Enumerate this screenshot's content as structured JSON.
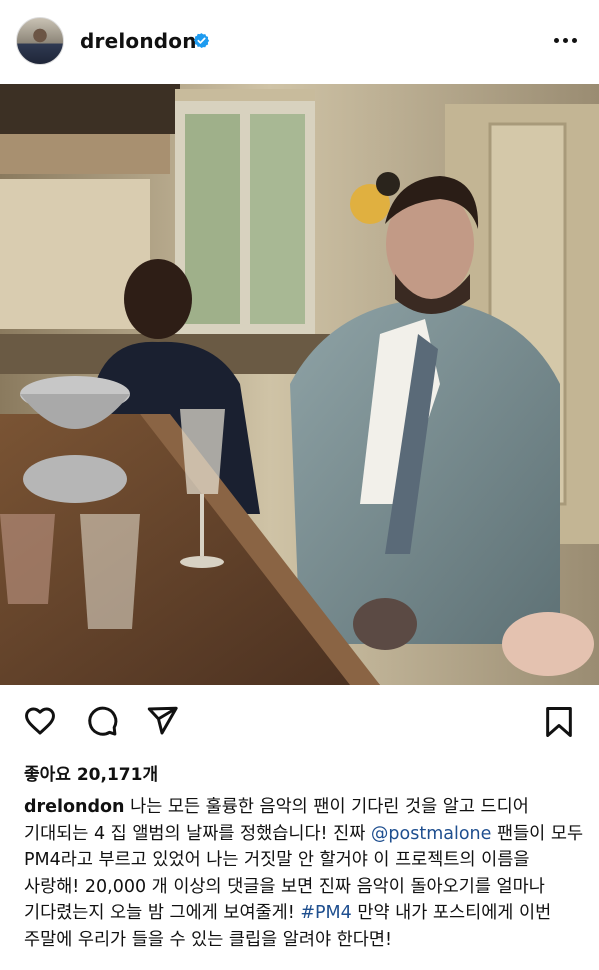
{
  "post": {
    "username": "drelondon",
    "verified": true,
    "avatar_label": "profile picture",
    "more_icon": "more-horizontal-icon",
    "image_alt": "Two men seated at a long wooden dining table in a rustic kitchen"
  },
  "actions": {
    "like_icon": "heart-icon",
    "comment_icon": "comment-icon",
    "share_icon": "send-icon",
    "save_icon": "bookmark-icon"
  },
  "likes": {
    "text": "좋아요 20,171개"
  },
  "caption": {
    "username": "drelondon",
    "part1": "나는 모든 훌륭한 음악의 팬이 기다린 것을 알고 드디어 기대되는 4 집 앨범의 날짜를 정했습니다! 진짜",
    "mention": "@postmalone",
    "part2": "팬들이 모두 PM4라고 부르고 있었어 나는 거짓말 안 할거야 이 프로젝트의 이름을 사랑해! 20,000 개 이상의 댓글을 보면 진짜 음악이 돌아오기를 얼마나 기다렸는지 오늘 밤 그에게 보여줄게!",
    "hashtag": "#PM4",
    "part3": "만약 내가 포스티에게 이번 주말에 우리가 들을 수 있는 클립을 알려야 한다면!"
  },
  "colors": {
    "verified_blue": "#1d9bf0",
    "link_blue": "#1f4f8f",
    "text": "#111111"
  }
}
